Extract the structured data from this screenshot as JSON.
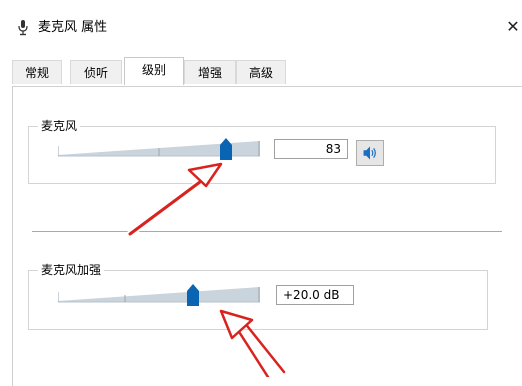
{
  "window": {
    "title": "麦克风 属性",
    "close_glyph": "✕",
    "icon": "microphone-icon"
  },
  "tabs": [
    {
      "label": "常规",
      "active": false
    },
    {
      "label": "侦听",
      "active": false
    },
    {
      "label": "级别",
      "active": true
    },
    {
      "label": "增强",
      "active": false
    },
    {
      "label": "高级",
      "active": false
    }
  ],
  "microphone": {
    "label": "麦克风",
    "value": "83",
    "level": 0.83,
    "mute_icon": "speaker-icon"
  },
  "boost": {
    "label": "麦克风加强",
    "value": "+20.0 dB",
    "level": 0.67
  },
  "colors": {
    "thumb": "#0a64b4",
    "arrow": "#d8231e",
    "slider_fill": "#c9d4dd"
  }
}
